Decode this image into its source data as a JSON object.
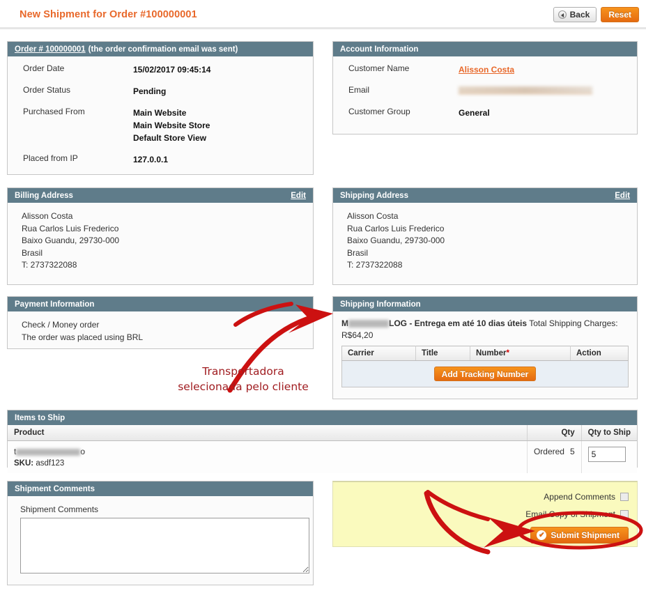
{
  "header": {
    "title": "New Shipment for Order #100000001",
    "back_label": "Back",
    "reset_label": "Reset"
  },
  "order_panel": {
    "order_link": "Order # 100000001",
    "note": "(the order confirmation email was sent)",
    "rows": [
      {
        "label": "Order Date",
        "value": "15/02/2017 09:45:14"
      },
      {
        "label": "Order Status",
        "value": "Pending"
      },
      {
        "label": "Purchased From",
        "value": "Main Website\nMain Website Store\nDefault Store View"
      },
      {
        "label": "Placed from IP",
        "value": "127.0.0.1"
      }
    ]
  },
  "account_panel": {
    "title": "Account Information",
    "rows": [
      {
        "label": "Customer Name",
        "value": "Alisson Costa"
      },
      {
        "label": "Email",
        "value": ""
      },
      {
        "label": "Customer Group",
        "value": "General"
      }
    ]
  },
  "billing_panel": {
    "title": "Billing Address",
    "edit_label": "Edit",
    "lines": [
      "Alisson Costa",
      "Rua Carlos Luis Frederico",
      "Baixo Guandu, 29730-000",
      "Brasil",
      "T: 2737322088"
    ]
  },
  "shipping_panel": {
    "title": "Shipping Address",
    "edit_label": "Edit",
    "lines": [
      "Alisson Costa",
      "Rua Carlos Luis Frederico",
      "Baixo Guandu, 29730-000",
      "Brasil",
      "T: 2737322088"
    ]
  },
  "payment_panel": {
    "title": "Payment Information",
    "lines": [
      "Check / Money order",
      "The order was placed using BRL"
    ]
  },
  "shipping_info_panel": {
    "title": "Shipping Information",
    "carrier_prefix": "M",
    "carrier_suffix": "LOG - Entrega em até 10 dias úteis",
    "charges_label": "Total Shipping Charges:",
    "charges_value": "R$64,20",
    "table_headers": [
      "Carrier",
      "Title",
      "Number",
      "Action"
    ],
    "number_required_mark": "*",
    "add_tracking_label": "Add Tracking Number"
  },
  "items_panel": {
    "title": "Items to Ship",
    "headers": [
      "Product",
      "Qty",
      "Qty to Ship"
    ],
    "rows": [
      {
        "product_prefix": "t",
        "product_suffix": "o",
        "sku_label": "SKU:",
        "sku_value": "asdf123",
        "qty_label": "Ordered",
        "qty_value": "5",
        "qty_to_ship": "5"
      }
    ]
  },
  "comments_panel": {
    "title": "Shipment Comments",
    "field_label": "Shipment Comments",
    "value": "",
    "placeholder": ""
  },
  "submit_panel": {
    "append_comments_label": "Append Comments",
    "email_copy_label": "Email Copy of Shipment",
    "submit_label": "Submit Shipment",
    "check_glyph": "✔"
  },
  "annotations": [
    {
      "text": "Transportadora\nselecionada pelo cliente"
    }
  ],
  "colors": {
    "panel_header": "#5f7c8a",
    "accent_orange": "#e8682a",
    "annotation_red": "#cc1111",
    "submit_box_yellow": "#fafabe"
  }
}
